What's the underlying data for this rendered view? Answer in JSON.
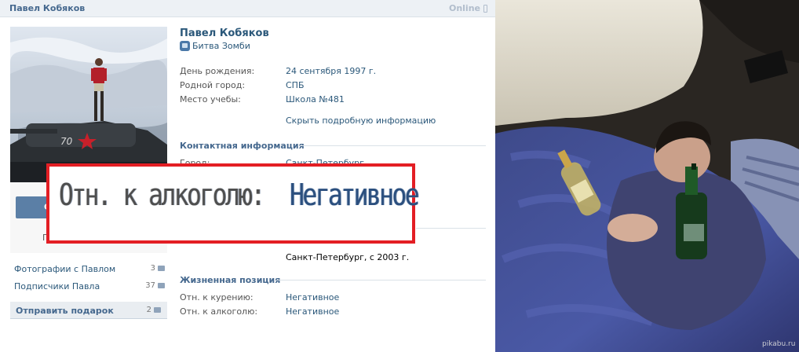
{
  "header": {
    "name": "Павел Кобяков",
    "online": "Online"
  },
  "profile": {
    "name": "Павел Кобяков",
    "status_app": "Битва Зомби",
    "info": [
      {
        "label": "День рождения:",
        "value": "24 сентября 1997 г."
      },
      {
        "label": "Родной город:",
        "value": "СПБ"
      },
      {
        "label": "Место учебы:",
        "value": "Школа №481"
      }
    ],
    "hide_info_link": "Скрыть подробную информацию",
    "contacts_title": "Контактная информация",
    "city_label": "Город:",
    "city_value": "Санкт-Петербург",
    "education_value": "Санкт-Петербург, с 2003 г.",
    "life_title": "Жизненная позиция",
    "life": [
      {
        "label": "Отн. к курению:",
        "value": "Негативное"
      },
      {
        "label": "Отн. к алкоголю:",
        "value": "Негативное"
      }
    ]
  },
  "sidebar": {
    "send_stub": "С",
    "stub_text": "Г",
    "links": [
      {
        "label": "Фотографии с Павлом",
        "count": "3"
      },
      {
        "label": "Подписчики Павла",
        "count": "37"
      }
    ],
    "gift_label": "Отправить подарок",
    "gift_count": "2"
  },
  "zoom": {
    "label": "Отн. к алкоголю:",
    "value": "Негативное"
  },
  "watermark": "pikabu.ru",
  "colors": {
    "accent": "#2b587a",
    "highlight_border": "#e31e24"
  }
}
